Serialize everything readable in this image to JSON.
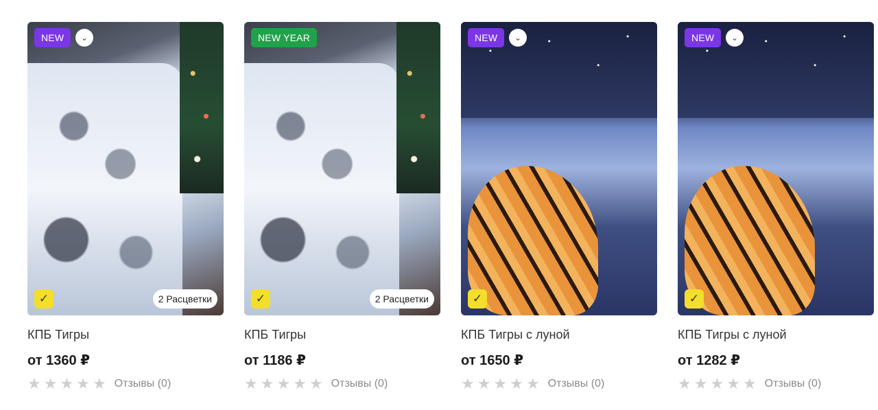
{
  "colors": {
    "badge_new": "#7b36e8",
    "badge_new_year": "#1fa34a",
    "check_badge": "#f3df2b",
    "star_empty": "#cfcfcf"
  },
  "products": [
    {
      "badge": "NEW",
      "photo": "tiger-print-bedding-white",
      "colors_label": "2 Расцветки",
      "name": "КПБ Тигры",
      "price": "от 1360 ₽",
      "rating": 0,
      "reviews": "Отзывы (0)"
    },
    {
      "badge": "NEW YEAR",
      "photo": "tiger-print-bedding-white",
      "colors_label": "2 Расцветки",
      "name": "КПБ Тигры",
      "price": "от 1186 ₽",
      "rating": 0,
      "reviews": "Отзывы (0)"
    },
    {
      "badge": "NEW",
      "photo": "tiger-moon-bedding-blue",
      "name": "КПБ Тигры с луной",
      "price": "от 1650 ₽",
      "rating": 0,
      "reviews": "Отзывы (0)"
    },
    {
      "badge": "NEW",
      "photo": "tiger-moon-bedding-blue",
      "name": "КПБ Тигры с луной",
      "price": "от 1282 ₽",
      "rating": 0,
      "reviews": "Отзывы (0)"
    }
  ],
  "icons": {
    "chevron": "chevron-down-icon",
    "check": "verified-check-icon",
    "star": "star-icon"
  }
}
